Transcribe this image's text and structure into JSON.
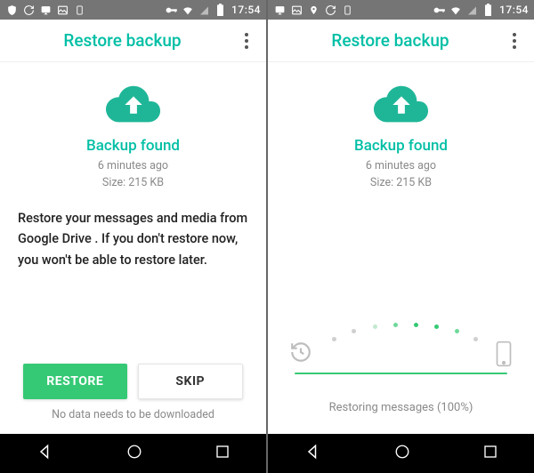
{
  "status": {
    "time": "17:54"
  },
  "header": {
    "title": "Restore backup"
  },
  "backup": {
    "title": "Backup found",
    "time": "6 minutes ago",
    "size": "Size: 215 KB"
  },
  "left": {
    "description": "Restore your messages and media from Google Drive . If you don't restore now, you won't be able to restore later.",
    "restore_label": "RESTORE",
    "skip_label": "SKIP",
    "footer": "No data needs to be downloaded"
  },
  "right": {
    "status": "Restoring messages (100%)"
  }
}
